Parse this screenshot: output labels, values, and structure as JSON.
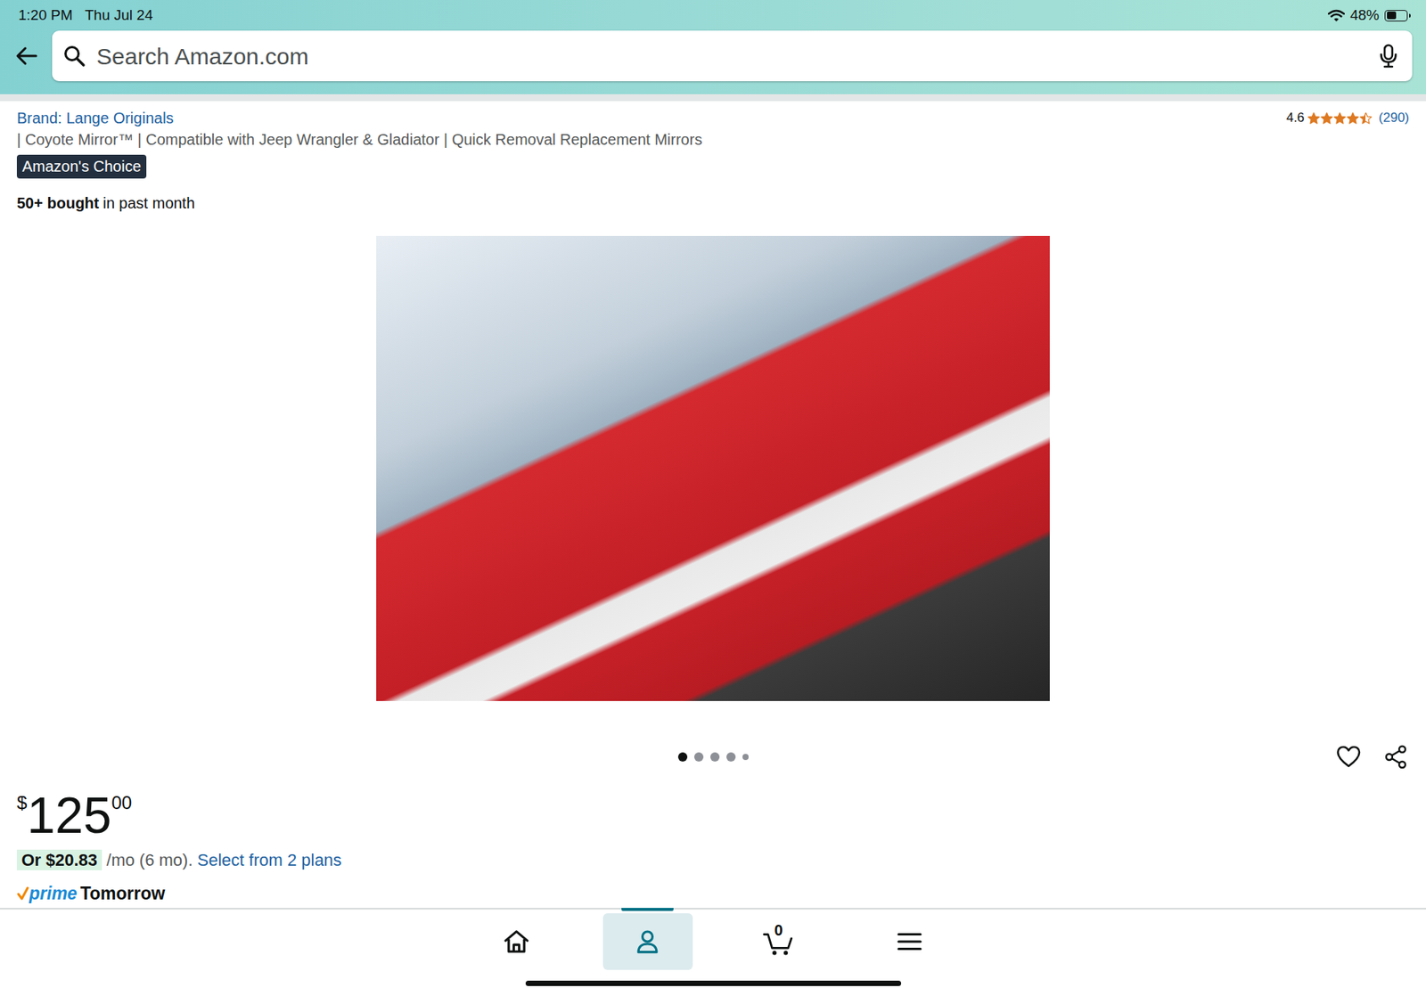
{
  "status_bar": {
    "time": "1:20 PM",
    "date": "Thu Jul 24",
    "battery": "48%",
    "battery_level": 0.48
  },
  "search": {
    "placeholder": "Search Amazon.com"
  },
  "product": {
    "brand": "Brand: Lange Originals",
    "rating": "4.6",
    "stars": 4.5,
    "review_count": "(290)",
    "title": "| Coyote Mirror™ | Compatible with Jeep Wrangler & Gladiator | Quick Removal Replacement Mirrors",
    "badge": "Amazon's Choice",
    "bought_bold": "50+ bought",
    "bought_rest": "in past month"
  },
  "carousel": {
    "dots": [
      {
        "selected": true
      },
      {
        "selected": false
      },
      {
        "selected": false
      },
      {
        "selected": false
      },
      {
        "selected": false
      }
    ]
  },
  "price": {
    "symbol": "$",
    "whole": "125",
    "fraction": "00"
  },
  "installment": {
    "amount": "Or $20.83",
    "rest": "/mo (6 mo).",
    "link": "Select from 2 plans"
  },
  "delivery": {
    "prime": "prime",
    "day": "Tomorrow"
  },
  "tab_bar": {
    "items": [
      {
        "kind": "home",
        "selected": false
      },
      {
        "kind": "account",
        "selected": true
      },
      {
        "kind": "cart",
        "selected": false,
        "count": "0"
      },
      {
        "kind": "menu",
        "selected": false
      }
    ]
  }
}
